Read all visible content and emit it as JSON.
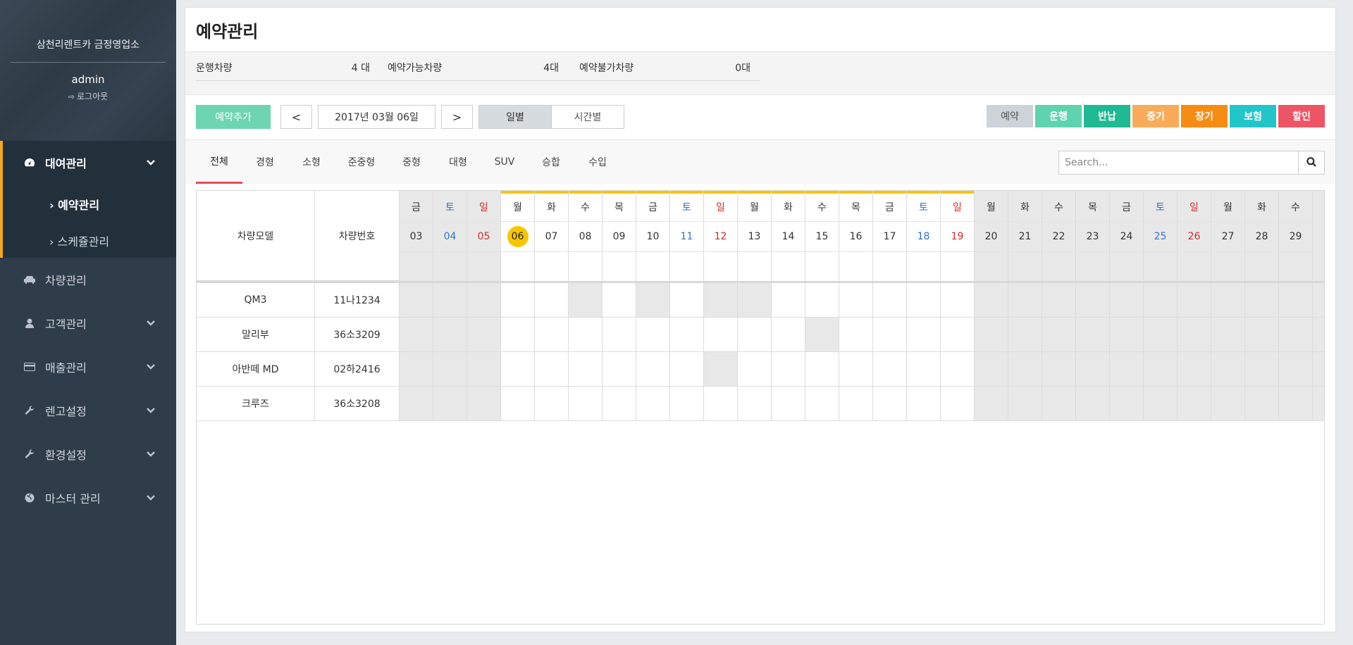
{
  "sidebar": {
    "company": "삼천리렌트카 금정영업소",
    "user": "admin",
    "logout": "로그아웃",
    "menu": [
      {
        "label": "대여관리",
        "icon": "dashboard-icon"
      },
      {
        "label": "차량관리",
        "icon": "car-icon"
      },
      {
        "label": "고객관리",
        "icon": "user-icon"
      },
      {
        "label": "매출관리",
        "icon": "credit-card-icon"
      },
      {
        "label": "렌고설정",
        "icon": "wrench-icon"
      },
      {
        "label": "환경설정",
        "icon": "wrench-icon"
      },
      {
        "label": "마스터 관리",
        "icon": "globe-icon"
      }
    ],
    "submenu": [
      {
        "label": "예약관리"
      },
      {
        "label": "스케쥴관리"
      }
    ]
  },
  "page": {
    "title": "예약관리"
  },
  "stats": [
    {
      "label": "운행차량",
      "value": "4 대"
    },
    {
      "label": "예약가능차량",
      "value": "4대"
    },
    {
      "label": "예약불가차량",
      "value": "0대"
    }
  ],
  "toolbar": {
    "add_label": "예약추가",
    "prev": "<",
    "next": ">",
    "date": "2017년 03월 06일",
    "view_daily": "일별",
    "view_hourly": "시간별"
  },
  "legend": [
    {
      "label": "예약",
      "color": "#cdd3d8"
    },
    {
      "label": "운행",
      "color": "#5fd3ad"
    },
    {
      "label": "반납",
      "color": "#1fb993"
    },
    {
      "label": "중기",
      "color": "#f8ac59"
    },
    {
      "label": "장기",
      "color": "#f78c15"
    },
    {
      "label": "보험",
      "color": "#23c6c8"
    },
    {
      "label": "할인",
      "color": "#ed5565"
    }
  ],
  "tabs": [
    "전체",
    "경형",
    "소형",
    "준중형",
    "중형",
    "대형",
    "SUV",
    "승합",
    "수입"
  ],
  "search": {
    "placeholder": "Search..."
  },
  "schedule": {
    "col_model": "차량모델",
    "col_number": "차량번호",
    "days": [
      {
        "dow": "금",
        "num": "03",
        "type": "weekday",
        "past": true
      },
      {
        "dow": "토",
        "num": "04",
        "type": "sat",
        "past": true
      },
      {
        "dow": "일",
        "num": "05",
        "type": "sun",
        "past": true
      },
      {
        "dow": "월",
        "num": "06",
        "type": "weekday",
        "today": true
      },
      {
        "dow": "화",
        "num": "07",
        "type": "weekday"
      },
      {
        "dow": "수",
        "num": "08",
        "type": "weekday"
      },
      {
        "dow": "목",
        "num": "09",
        "type": "weekday"
      },
      {
        "dow": "금",
        "num": "10",
        "type": "weekday"
      },
      {
        "dow": "토",
        "num": "11",
        "type": "sat"
      },
      {
        "dow": "일",
        "num": "12",
        "type": "sun"
      },
      {
        "dow": "월",
        "num": "13",
        "type": "weekday"
      },
      {
        "dow": "화",
        "num": "14",
        "type": "weekday"
      },
      {
        "dow": "수",
        "num": "15",
        "type": "weekday"
      },
      {
        "dow": "목",
        "num": "16",
        "type": "weekday"
      },
      {
        "dow": "금",
        "num": "17",
        "type": "weekday"
      },
      {
        "dow": "토",
        "num": "18",
        "type": "sat"
      },
      {
        "dow": "일",
        "num": "19",
        "type": "sun"
      },
      {
        "dow": "월",
        "num": "20",
        "type": "weekday",
        "past": true
      },
      {
        "dow": "화",
        "num": "21",
        "type": "weekday",
        "past": true
      },
      {
        "dow": "수",
        "num": "22",
        "type": "weekday",
        "past": true
      },
      {
        "dow": "목",
        "num": "23",
        "type": "weekday",
        "past": true
      },
      {
        "dow": "금",
        "num": "24",
        "type": "weekday",
        "past": true
      },
      {
        "dow": "토",
        "num": "25",
        "type": "sat",
        "past": true
      },
      {
        "dow": "일",
        "num": "26",
        "type": "sun",
        "past": true
      },
      {
        "dow": "월",
        "num": "27",
        "type": "weekday",
        "past": true
      },
      {
        "dow": "화",
        "num": "28",
        "type": "weekday",
        "past": true
      },
      {
        "dow": "수",
        "num": "29",
        "type": "weekday",
        "past": true
      }
    ],
    "rows": [
      {
        "model": "QM3",
        "number": "11나1234",
        "gray_days": [
          0,
          1,
          2,
          5,
          7,
          9,
          10
        ]
      },
      {
        "model": "말리부",
        "number": "36소3209",
        "gray_days": [
          0,
          1,
          2,
          12
        ]
      },
      {
        "model": "아반떼 MD",
        "number": "02하2416",
        "gray_days": [
          0,
          1,
          2,
          9
        ]
      },
      {
        "model": "크루즈",
        "number": "36소3208",
        "gray_days": [
          0,
          1,
          2
        ]
      }
    ]
  }
}
